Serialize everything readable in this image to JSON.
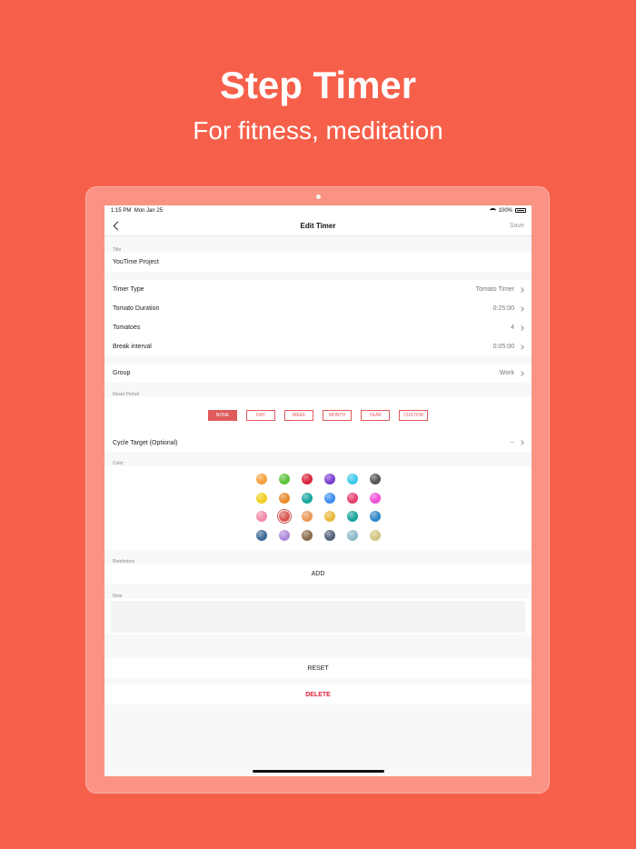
{
  "promo": {
    "headline": "Step Timer",
    "subhead": "For fitness, meditation"
  },
  "status": {
    "time": "1:15 PM",
    "date": "Mon Jan 25",
    "battery": "100%"
  },
  "nav": {
    "title": "Edit Timer",
    "save": "Save"
  },
  "title_section": {
    "label": "Title",
    "value": "YouTime Project"
  },
  "timer": {
    "rows": [
      {
        "label": "Timer Type",
        "value": "Tomato Timer"
      },
      {
        "label": "Tomato Duration",
        "value": "0:25:00"
      },
      {
        "label": "Tomatoes",
        "value": "4"
      },
      {
        "label": "Break interval",
        "value": "0:05:00"
      }
    ]
  },
  "group": {
    "label": "Group",
    "value": "Work"
  },
  "reset_period": {
    "label": "Reset Period",
    "options": [
      "NONE",
      "DAY",
      "WEEK",
      "MONTH",
      "YEAR",
      "CUSTOM"
    ],
    "selected": "NONE"
  },
  "cycle_target": {
    "label": "Cycle Target (Optional)",
    "value": "--"
  },
  "color_section": {
    "label": "Color",
    "rows": [
      [
        "#f5a03b",
        "#5cc23a",
        "#d8243a",
        "#7a3fd0",
        "#3ec9e8",
        "#555555"
      ],
      [
        "#f2cf1d",
        "#e98a2c",
        "#17a7a0",
        "#3b8ef0",
        "#e53d6a",
        "#ef4fd6"
      ],
      [
        "#f28aa7",
        "#d9564f",
        "#e99656",
        "#e9b93b",
        "#1aa39b",
        "#2f86c6"
      ],
      [
        "#3d6a96",
        "#b08ad9",
        "#8a6a4c",
        "#556178",
        "#8db9c9",
        "#d3c582"
      ]
    ],
    "selected": "#d9564f"
  },
  "reminders": {
    "label": "Reminders",
    "add": "ADD"
  },
  "note": {
    "label": "Note"
  },
  "actions": {
    "reset": "RESET",
    "delete": "DELETE"
  }
}
